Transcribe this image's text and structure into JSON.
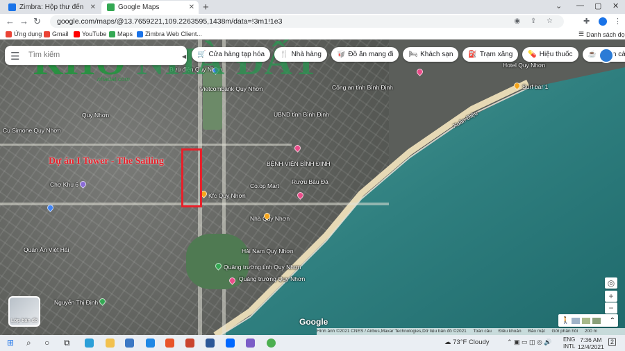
{
  "browser": {
    "tabs": [
      {
        "label": "Zimbra: Hộp thư đến",
        "favicon_color": "#1a73e8"
      },
      {
        "label": "Google Maps",
        "favicon_color": "#34a853"
      }
    ],
    "new_tab_icon": "+",
    "address": "google.com/maps/@13.7659221,109.2263595,1438m/data=!3m1!1e3",
    "bookmarks": [
      {
        "label": "Ứng dụng",
        "color": "#ea4335"
      },
      {
        "label": "Gmail",
        "color": "#ea4335"
      },
      {
        "label": "YouTube",
        "color": "#ff0000"
      },
      {
        "label": "Maps",
        "color": "#34a853"
      },
      {
        "label": "Zimbra Web Client...",
        "color": "#1a73e8"
      }
    ],
    "reading_list": "Danh sách đọc"
  },
  "maps": {
    "search_placeholder": "Tìm kiếm",
    "chips": [
      {
        "label": "Cửa hàng tạp hóa",
        "icon": "🛒"
      },
      {
        "label": "Nhà hàng",
        "icon": "🍴"
      },
      {
        "label": "Đồ ăn mang đi",
        "icon": "🥡"
      },
      {
        "label": "Khách sạn",
        "icon": "🛏"
      },
      {
        "label": "Trạm xăng",
        "icon": "⛽"
      },
      {
        "label": "Hiệu thuốc",
        "icon": "💊"
      },
      {
        "label": "Quán cà phê",
        "icon": "☕"
      }
    ],
    "labels": [
      {
        "text": "Vietcombank Quy Nhơn"
      },
      {
        "text": "Quy Nhơn"
      },
      {
        "text": "Cụ Simone Quy Nhơn"
      },
      {
        "text": "Chợ Khu 6"
      },
      {
        "text": "UBND tỉnh Bình Định"
      },
      {
        "text": "Công an tỉnh Bình Định"
      },
      {
        "text": "BỆNH VIỆN BÌNH ĐỊNH"
      },
      {
        "text": "Kfc Quy Nhơn"
      },
      {
        "text": "Co.op Mart"
      },
      {
        "text": "Rượu Bàu Đá"
      },
      {
        "text": "Quán Ăn Việt Hải"
      },
      {
        "text": "Nguyễn Thị Định"
      },
      {
        "text": "Quảng trường tỉnh Quy Nhơn"
      },
      {
        "text": "Hải Nam Quy Nhơn"
      },
      {
        "text": "Quảng trường Quy Nhơn"
      },
      {
        "text": "Surf bar 1"
      },
      {
        "text": "Xuân Diệu"
      },
      {
        "text": "Hotel Quy Nhơn"
      },
      {
        "text": "Bưu điện Quy Nhơn"
      },
      {
        "text": "Nhà Quy Nhơn"
      }
    ],
    "layer_label": "Lớp bản đồ",
    "logo": "Google",
    "attribution": [
      "Hình ảnh ©2021 CNES / Airbus,Maxar Technologies,Dữ liệu bản đồ ©2021",
      "Toàn cầu",
      "Điều khoản",
      "Bảo mật",
      "Gửi phản hồi",
      "200 m"
    ]
  },
  "overlay": {
    "watermark_a": "KHO",
    "watermark_b": "NHÀ ĐẤT",
    "watermark_sub": "nhadat.com",
    "project_title": "Dự án I Tower - The Sailing"
  },
  "taskbar": {
    "weather": "73°F Cloudy",
    "lang_1": "ENG",
    "lang_2": "INTL",
    "time": "7:36 AM",
    "date": "12/4/2021",
    "notif": "2"
  }
}
